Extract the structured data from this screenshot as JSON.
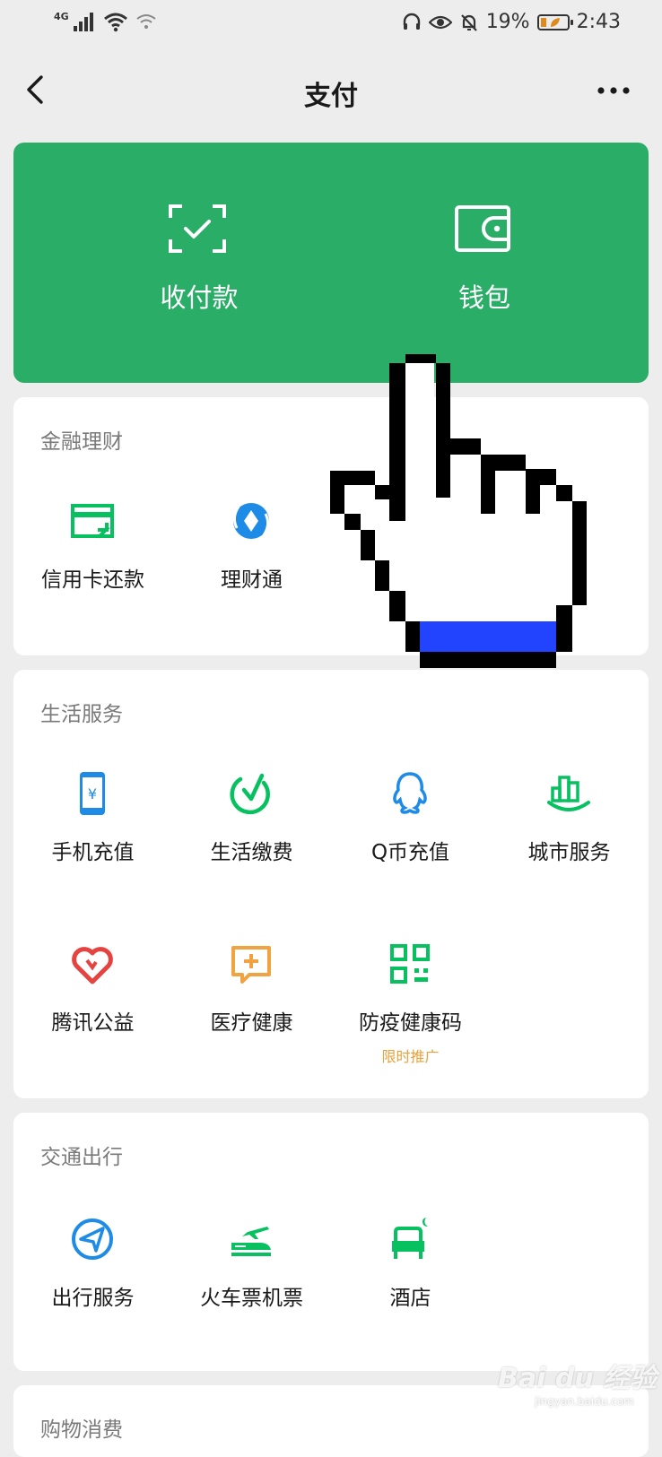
{
  "status_bar": {
    "network": "4G",
    "battery": "19%",
    "battery_level": 0.19,
    "time": "2:43"
  },
  "nav": {
    "title": "支付"
  },
  "top_card": {
    "items": [
      {
        "label": "收付款",
        "icon": "scan-pay-icon"
      },
      {
        "label": "钱包",
        "icon": "wallet-icon"
      }
    ]
  },
  "finance": {
    "title": "金融理财",
    "items": [
      {
        "label": "信用卡还款",
        "icon": "credit-card-icon"
      },
      {
        "label": "理财通",
        "icon": "wealth-icon"
      }
    ]
  },
  "life": {
    "title": "生活服务",
    "items": [
      {
        "label": "手机充值",
        "icon": "phone-recharge-icon"
      },
      {
        "label": "生活缴费",
        "icon": "utility-bill-icon"
      },
      {
        "label": "Q币充值",
        "icon": "qq-coin-icon"
      },
      {
        "label": "城市服务",
        "icon": "city-service-icon"
      },
      {
        "label": "腾讯公益",
        "icon": "charity-heart-icon"
      },
      {
        "label": "医疗健康",
        "icon": "medical-icon"
      },
      {
        "label": "防疫健康码",
        "icon": "qr-code-icon",
        "sub": "限时推广"
      }
    ]
  },
  "transport": {
    "title": "交通出行",
    "items": [
      {
        "label": "出行服务",
        "icon": "travel-icon"
      },
      {
        "label": "火车票机票",
        "icon": "train-plane-icon"
      },
      {
        "label": "酒店",
        "icon": "hotel-icon"
      }
    ]
  },
  "shopping": {
    "title": "购物消费"
  },
  "watermark": {
    "text": "Bai du 经验",
    "url": "jingyan.baidu.com"
  },
  "colors": {
    "brand_green": "#2aae67",
    "icon_green": "#07c160",
    "icon_blue": "#1e8be6",
    "icon_red": "#e64340",
    "icon_orange": "#f0a340",
    "promo": "#e6a23c"
  }
}
